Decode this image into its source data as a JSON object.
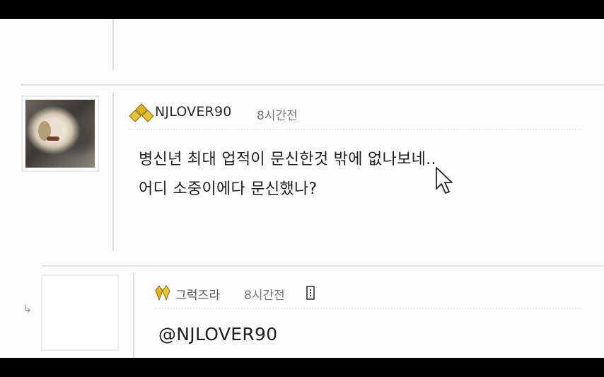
{
  "comment": {
    "username": "NJLOVER90",
    "time": "8시간전",
    "lines": [
      "병신년 최대 업적이 문신한것 밖에 없나보네..",
      "어디 소중이에다 문신했나?"
    ]
  },
  "reply": {
    "arrow": "↳",
    "username": "그럭즈라",
    "time": "8시간전",
    "text": "@NJLOVER90"
  },
  "icons": {
    "badge": "gold-rank-badge-icon",
    "cursor": "mouse-pointer-icon",
    "menu": "more-menu-icon"
  },
  "colors": {
    "badge_gold": "#e0b21c",
    "text": "#1f1f1f",
    "muted": "#777777"
  }
}
